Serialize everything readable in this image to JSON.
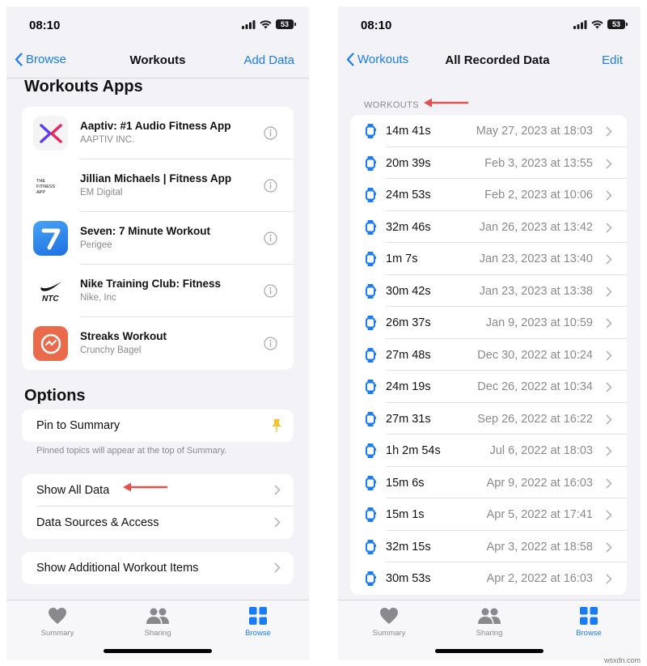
{
  "left": {
    "status": {
      "time": "08:10",
      "battery": "53"
    },
    "nav": {
      "back": "Browse",
      "title": "Workouts",
      "action": "Add Data"
    },
    "apps_heading": "Workouts Apps",
    "apps": [
      {
        "name": "Aaptiv: #1 Audio Fitness App",
        "developer": "AAPTIV INC.",
        "icon": "aaptiv-logo"
      },
      {
        "name": "Jillian Michaels | Fitness App",
        "developer": "EM Digital",
        "icon": "the-fitness-app-logo"
      },
      {
        "name": "Seven: 7 Minute Workout",
        "developer": "Perigee",
        "icon": "seven-logo"
      },
      {
        "name": "Nike Training Club: Fitness",
        "developer": "Nike, Inc",
        "icon": "ntc-logo"
      },
      {
        "name": "Streaks Workout",
        "developer": "Crunchy Bagel",
        "icon": "streaks-logo"
      }
    ],
    "options_heading": "Options",
    "pin_label": "Pin to Summary",
    "pin_note": "Pinned topics will appear at the top of Summary.",
    "show_all": "Show All Data",
    "data_sources": "Data Sources & Access",
    "additional": "Show Additional Workout Items",
    "tabs": [
      {
        "label": "Summary",
        "icon": "heart-icon",
        "active": false
      },
      {
        "label": "Sharing",
        "icon": "people-icon",
        "active": false
      },
      {
        "label": "Browse",
        "icon": "grid-icon",
        "active": true
      }
    ]
  },
  "right": {
    "status": {
      "time": "08:10",
      "battery": "53"
    },
    "nav": {
      "back": "Workouts",
      "title": "All Recorded Data",
      "action": "Edit"
    },
    "section": "WORKOUTS",
    "workouts": [
      {
        "duration": "14m 41s",
        "date": "May 27, 2023 at 18:03"
      },
      {
        "duration": "20m 39s",
        "date": "Feb 3, 2023 at 13:55"
      },
      {
        "duration": "24m 53s",
        "date": "Feb 2, 2023 at 10:06"
      },
      {
        "duration": "32m 46s",
        "date": "Jan 26, 2023 at 13:42"
      },
      {
        "duration": "1m 7s",
        "date": "Jan 23, 2023 at 13:40"
      },
      {
        "duration": "30m 42s",
        "date": "Jan 23, 2023 at 13:38"
      },
      {
        "duration": "26m 37s",
        "date": "Jan 9, 2023 at 10:59"
      },
      {
        "duration": "27m 48s",
        "date": "Dec 30, 2022 at 10:24"
      },
      {
        "duration": "24m 19s",
        "date": "Dec 26, 2022 at 10:34"
      },
      {
        "duration": "27m 31s",
        "date": "Sep 26, 2022 at 16:22"
      },
      {
        "duration": "1h 2m 54s",
        "date": "Jul 6, 2022 at 18:03"
      },
      {
        "duration": "15m 6s",
        "date": "Apr 9, 2022 at 16:03"
      },
      {
        "duration": "15m 1s",
        "date": "Apr 5, 2022 at 17:41"
      },
      {
        "duration": "32m 15s",
        "date": "Apr 3, 2022 at 18:58"
      },
      {
        "duration": "30m 53s",
        "date": "Apr 2, 2022 at 16:03"
      }
    ],
    "tabs": [
      {
        "label": "Summary",
        "icon": "heart-icon",
        "active": false
      },
      {
        "label": "Sharing",
        "icon": "people-icon",
        "active": false
      },
      {
        "label": "Browse",
        "icon": "grid-icon",
        "active": true
      }
    ]
  },
  "watermark": "wsxdn.com",
  "colors": {
    "accent": "#1a7cf5",
    "arrow": "#e0524f",
    "pin": "#f2c530"
  }
}
